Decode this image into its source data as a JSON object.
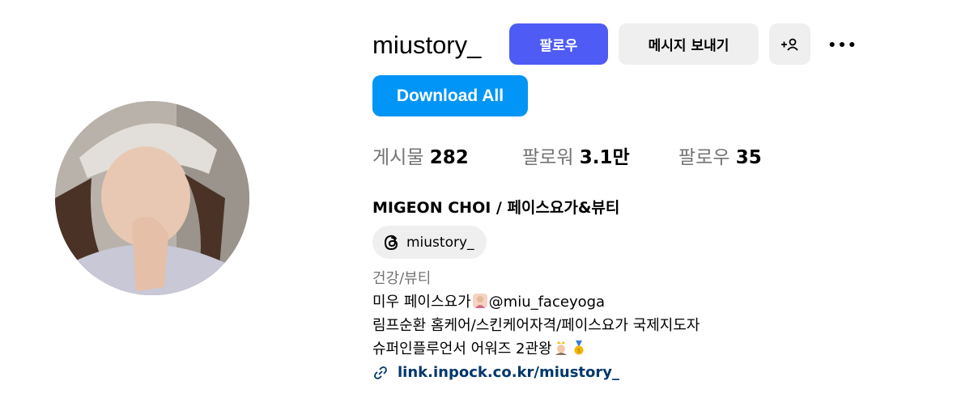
{
  "profile": {
    "username": "miustory_",
    "follow_label": "팔로우",
    "message_label": "메시지 보내기",
    "download_label": "Download All",
    "full_name": "MIGEON CHOI / 페이스요가&뷰티",
    "threads_handle": "miustory_"
  },
  "stats": {
    "posts_label": "게시물",
    "posts_value": "282",
    "followers_label": "팔로워",
    "followers_value": "3.1만",
    "following_label": "팔로우",
    "following_value": "35"
  },
  "bio": {
    "category": "건강/뷰티",
    "line1_a": "미우 페이스요가",
    "line1_b": "@miu_faceyoga",
    "line2": "림프순환 홈케어/스킨케어자격/페이스요가 국제지도자",
    "line3": "슈퍼인플루언서 어워즈 2관왕",
    "link": "link.inpock.co.kr/miustory_"
  },
  "icons": {
    "add_person": "add-person-icon",
    "more": "more-dots-icon",
    "threads": "threads-icon",
    "link": "link-icon"
  },
  "colors": {
    "follow": "#4f5bf5",
    "download": "#0095f6",
    "link": "#00376b"
  }
}
